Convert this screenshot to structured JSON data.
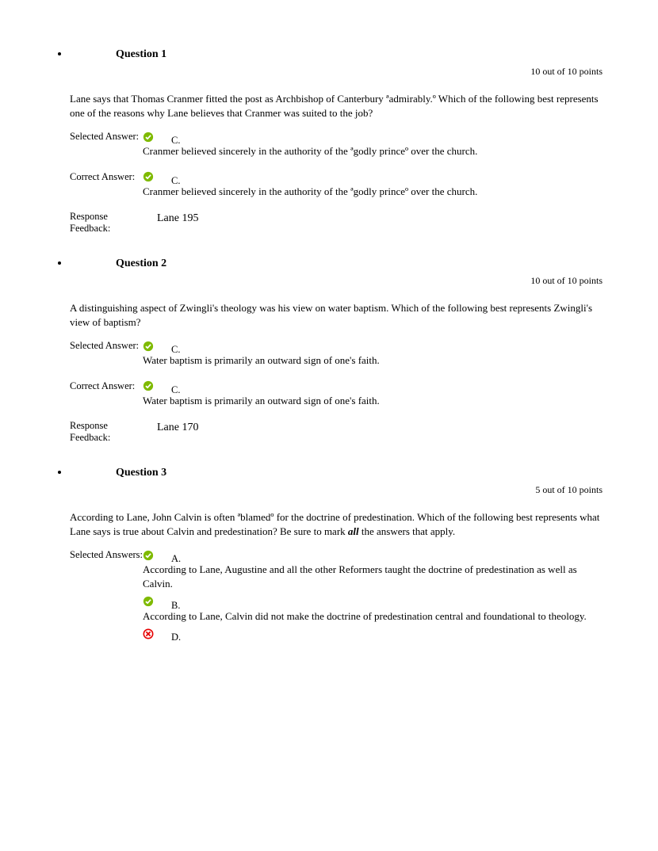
{
  "questions": [
    {
      "title": "Question 1",
      "score": "10 out of 10 points",
      "prompt": "Lane says that Thomas Cranmer fitted the post as Archbishop of Canterbury ªadmirably.º Which of the following best represents one of the reasons why Lane believes that Cranmer was suited to the job?",
      "selected_label": "Selected Answer:",
      "selected": [
        {
          "icon": "check",
          "letter": "C.",
          "text": "Cranmer believed sincerely in the authority of the ªgodly princeº over the church."
        }
      ],
      "correct_label": "Correct Answer:",
      "correct": [
        {
          "icon": "check",
          "letter": "C.",
          "text": "Cranmer believed sincerely in the authority of the ªgodly princeº over the church."
        }
      ],
      "feedback_label": "Response Feedback:",
      "feedback": "Lane 195"
    },
    {
      "title": "Question 2",
      "score": "10 out of 10 points",
      "prompt": "A distinguishing aspect of Zwingli's theology was his view on water baptism. Which of the following best represents Zwingli's view of baptism?",
      "selected_label": "Selected Answer:",
      "selected": [
        {
          "icon": "check",
          "letter": "C.",
          "text": "Water baptism is primarily an outward sign of one's faith."
        }
      ],
      "correct_label": "Correct Answer:",
      "correct": [
        {
          "icon": "check",
          "letter": "C.",
          "text": "Water baptism is primarily an outward sign of one's faith."
        }
      ],
      "feedback_label": "Response Feedback:",
      "feedback": "Lane 170"
    },
    {
      "title": "Question 3",
      "score": "5 out of 10 points",
      "prompt_html": "According to Lane, John Calvin is often ªblamedº for the doctrine of predestination. Which of the following best represents what Lane says is true about Calvin and predestination? Be sure to mark <em class='bi'>all</em> the answers that apply.",
      "selected_label": "Selected Answers:",
      "selected": [
        {
          "icon": "check",
          "letter": "A.",
          "text": "According to Lane, Augustine and all the other Reformers taught the doctrine of predestination as well as Calvin."
        },
        {
          "icon": "check",
          "letter": "B.",
          "text": "According to Lane, Calvin did not make the doctrine of predestination central and foundational to theology."
        },
        {
          "icon": "cross",
          "letter": "D.",
          "text": ""
        }
      ]
    }
  ]
}
